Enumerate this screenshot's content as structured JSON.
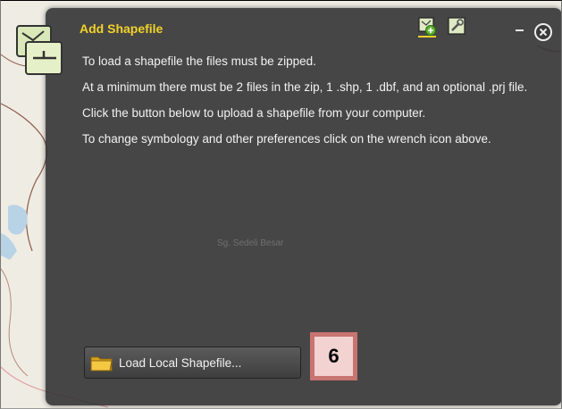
{
  "panel": {
    "title": "Add Shapefile",
    "icons": {
      "widget": "shapefile-icon",
      "add": "add-layer-icon",
      "settings": "wrench-settings-icon",
      "minimize": "minimize-icon",
      "close": "close-icon"
    },
    "paragraphs": [
      "To load a shapefile the files must be zipped.",
      "At a minimum there must be 2 files in the zip, 1 .shp, 1 .dbf, and an optional .prj file.",
      "Click the button below to upload a shapefile from your computer.",
      "To change symbology and other preferences click on the wrench icon above."
    ],
    "load_button_label": "Load Local Shapefile...",
    "load_button_icon": "folder-icon"
  },
  "map": {
    "place_label": "Sg. Sedeli Besar"
  },
  "callout": {
    "number": "6"
  },
  "colors": {
    "title": "#f1d22a",
    "panel": "#343434",
    "badge": "#c87470"
  }
}
